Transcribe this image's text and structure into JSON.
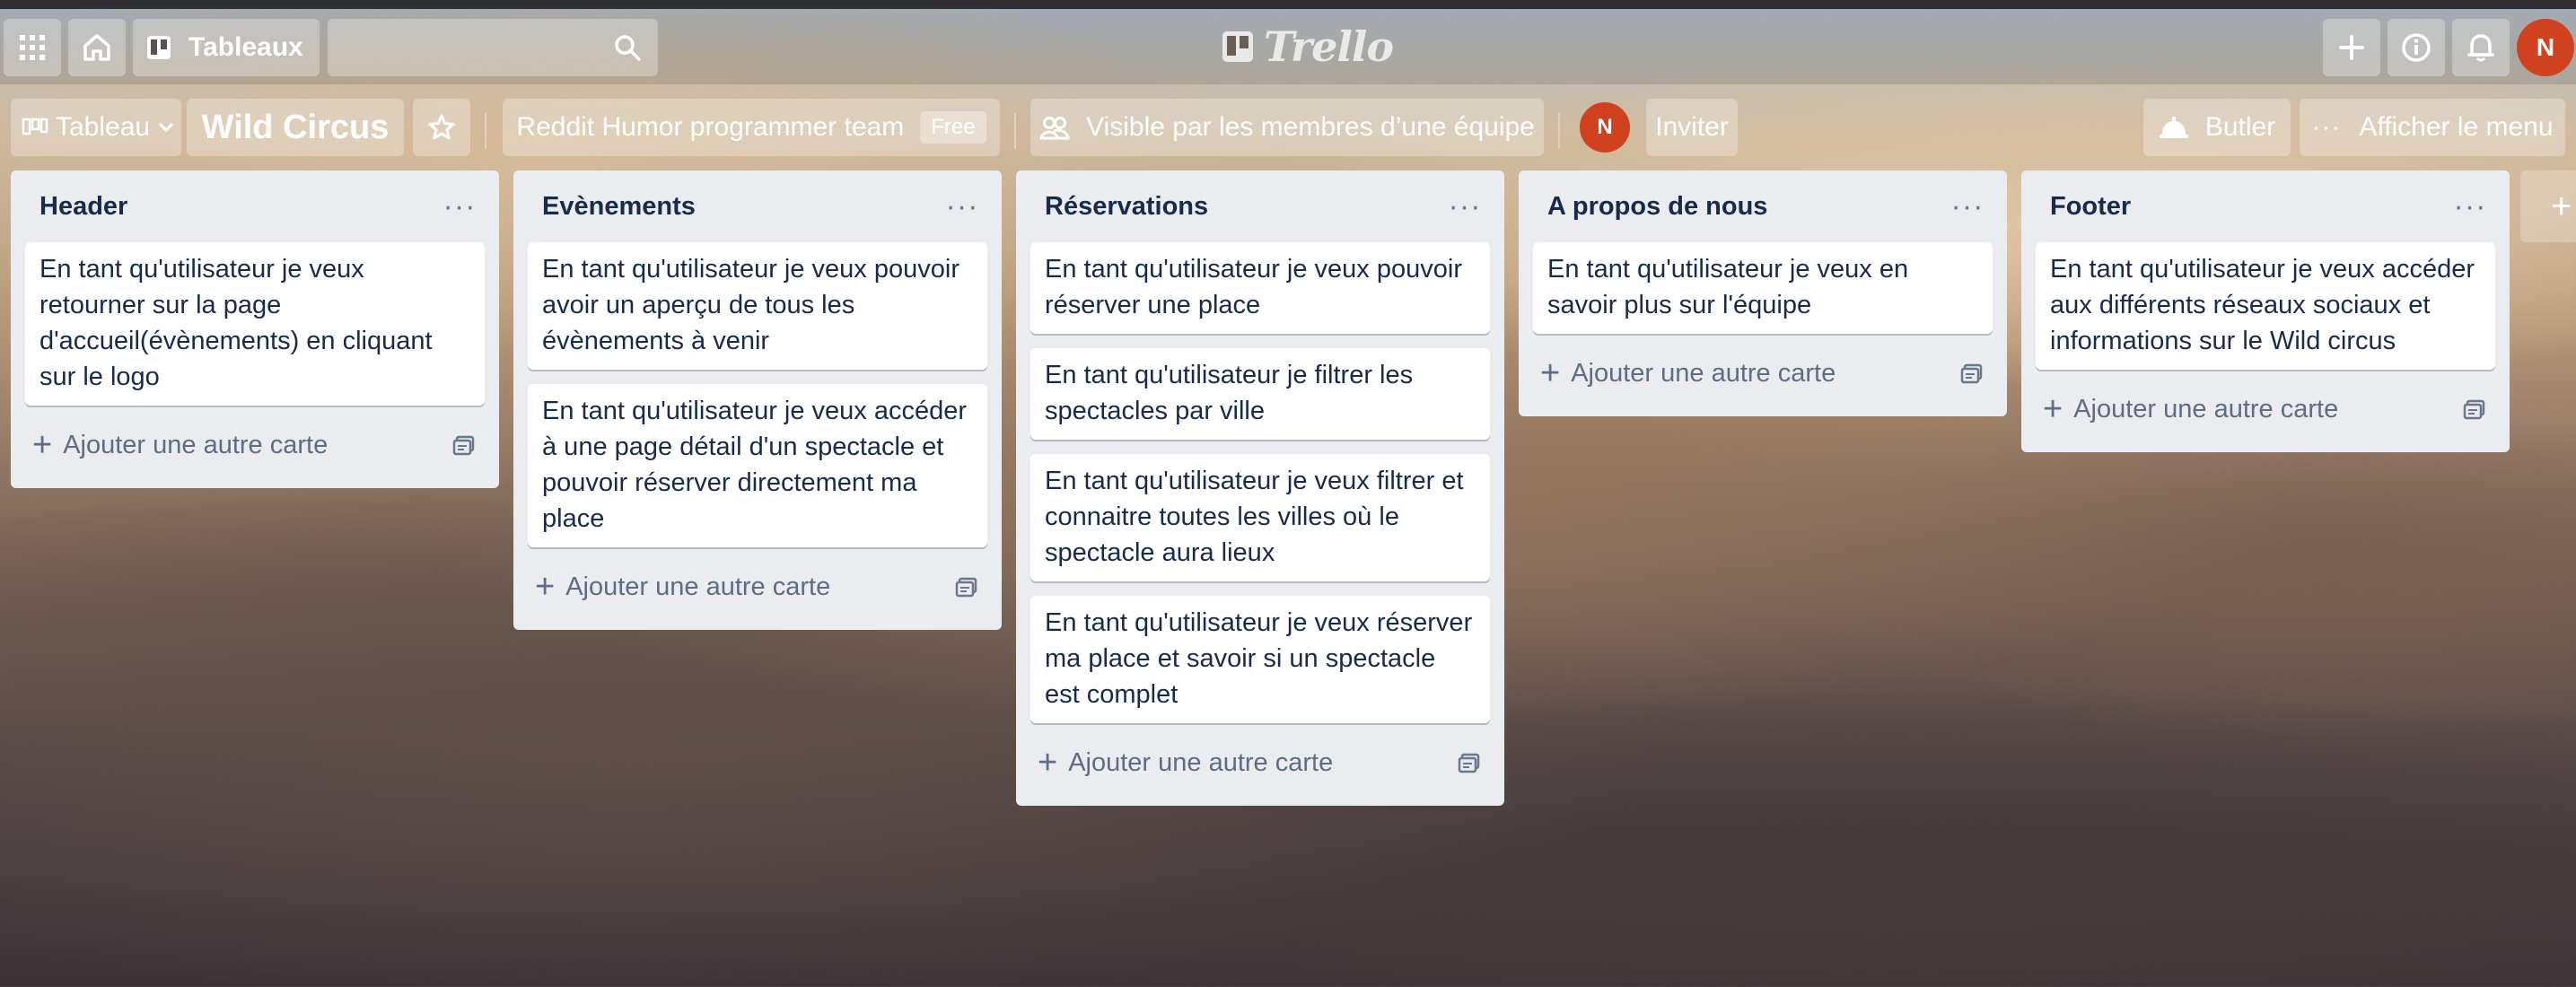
{
  "header": {
    "boards_label": "Tableaux",
    "search_placeholder": "",
    "logo_text": "Trello",
    "user_initial": "N"
  },
  "boardbar": {
    "view_label": "Tableau",
    "board_name": "Wild Circus",
    "team_name": "Reddit Humor programmer team",
    "team_badge": "Free",
    "visibility_label": "Visible par les membres d’une équipe",
    "member_initial": "N",
    "invite_label": "Inviter",
    "butler_label": "Butler",
    "menu_label": "Afficher le menu"
  },
  "lists": [
    {
      "title": "Header",
      "cards": [
        "En tant qu'utilisateur je veux retourner sur la page d'accueil(évènements) en cliquant sur le logo"
      ],
      "add_label": "Ajouter une autre carte"
    },
    {
      "title": "Evènements",
      "cards": [
        "En tant qu'utilisateur je veux pouvoir avoir un aperçu de tous les évènements à venir",
        "En tant qu'utilisateur je veux accéder à une page détail d'un spectacle et pouvoir réserver directement ma place"
      ],
      "add_label": "Ajouter une autre carte"
    },
    {
      "title": "Réservations",
      "cards": [
        "En tant qu'utilisateur je veux pouvoir réserver une place",
        "En tant qu'utilisateur je filtrer les spectacles par ville",
        "En tant qu'utilisateur je veux filtrer et connaitre toutes les villes où le spectacle aura lieux",
        "En tant qu'utilisateur je veux réserver ma place et savoir si un spectacle est complet"
      ],
      "add_label": "Ajouter une autre carte"
    },
    {
      "title": "A propos de nous",
      "cards": [
        "En tant qu'utilisateur je veux en savoir plus sur l'équipe"
      ],
      "add_label": "Ajouter une autre carte"
    },
    {
      "title": "Footer",
      "cards": [
        "En tant qu'utilisateur je veux accéder aux différents réseaux sociaux et informations sur le Wild circus"
      ],
      "add_label": "Ajouter une autre carte"
    }
  ],
  "add_list_glyph": "+",
  "colors": {
    "accent_avatar": "#d0411f",
    "list_bg": "#ebecf0",
    "card_text": "#172b4d"
  }
}
